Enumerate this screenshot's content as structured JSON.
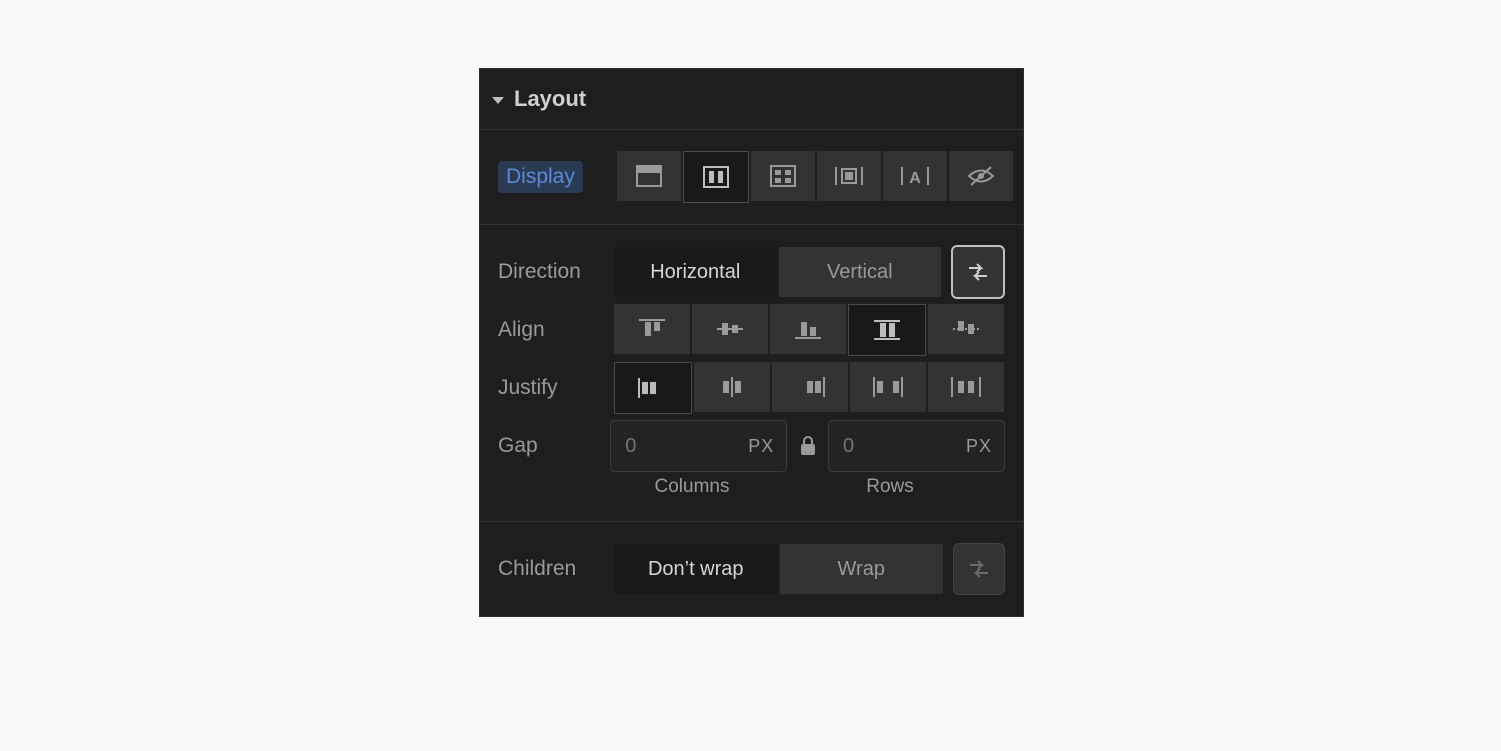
{
  "header": {
    "title": "Layout"
  },
  "display": {
    "label": "Display",
    "options": [
      "block",
      "flex",
      "grid",
      "inline-block",
      "inline",
      "none"
    ],
    "selected": "flex"
  },
  "direction": {
    "label": "Direction",
    "options": {
      "horizontal": "Horizontal",
      "vertical": "Vertical"
    },
    "selected": "horizontal",
    "reverse_button": "reverse-direction"
  },
  "align": {
    "label": "Align",
    "options": [
      "start",
      "center",
      "end",
      "stretch",
      "baseline"
    ],
    "selected": "stretch"
  },
  "justify": {
    "label": "Justify",
    "options": [
      "start",
      "center",
      "end",
      "space-between",
      "space-around"
    ],
    "selected": "start"
  },
  "gap": {
    "label": "Gap",
    "columns": {
      "placeholder": "0",
      "value": "",
      "unit": "PX",
      "sublabel": "Columns"
    },
    "rows": {
      "placeholder": "0",
      "value": "",
      "unit": "PX",
      "sublabel": "Rows"
    },
    "locked": true
  },
  "children": {
    "label": "Children",
    "options": {
      "nowrap": "Don’t wrap",
      "wrap": "Wrap"
    },
    "selected": "nowrap",
    "reverse_button": "reverse-wrap"
  }
}
